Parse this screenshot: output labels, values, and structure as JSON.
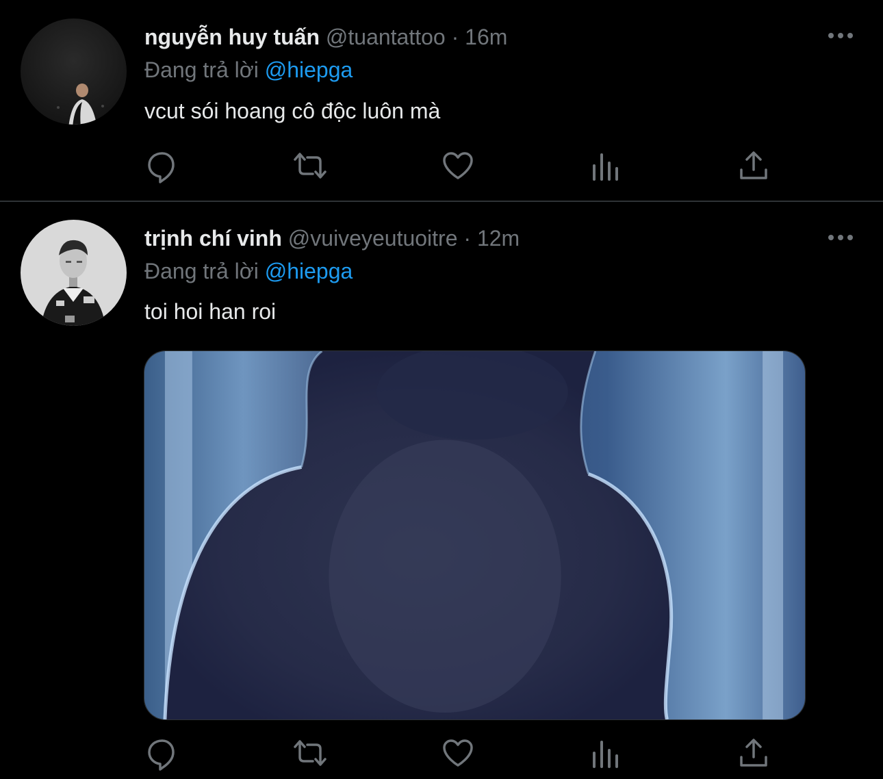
{
  "tweets": [
    {
      "name": "nguyễn huy tuấn",
      "handle": "@tuantattoo",
      "separator": "·",
      "time": "16m",
      "replying_to_label": "Đang trả lời",
      "replying_to": "@hiepga",
      "text": "vcut sói hoang cô độc luôn mà",
      "avatar_icon": "user-avatar-dark-night-photo"
    },
    {
      "name": "trịnh chí vinh",
      "handle": "@vuiveyeutuoitre",
      "separator": "·",
      "time": "12m",
      "replying_to_label": "Đang trả lời",
      "replying_to": "@hiepga",
      "text": "toi hoi han roi",
      "avatar_icon": "user-avatar-grayscale-portrait",
      "media_description_icon": "image-blurry-blue-figure"
    }
  ],
  "actions": [
    "reply-icon",
    "retweet-icon",
    "like-icon",
    "analytics-icon",
    "share-icon"
  ],
  "colors": {
    "background": "#000000",
    "text": "#e7e9ea",
    "secondary": "#71767b",
    "accent": "#1d9bf0",
    "divider": "#2f3336"
  }
}
